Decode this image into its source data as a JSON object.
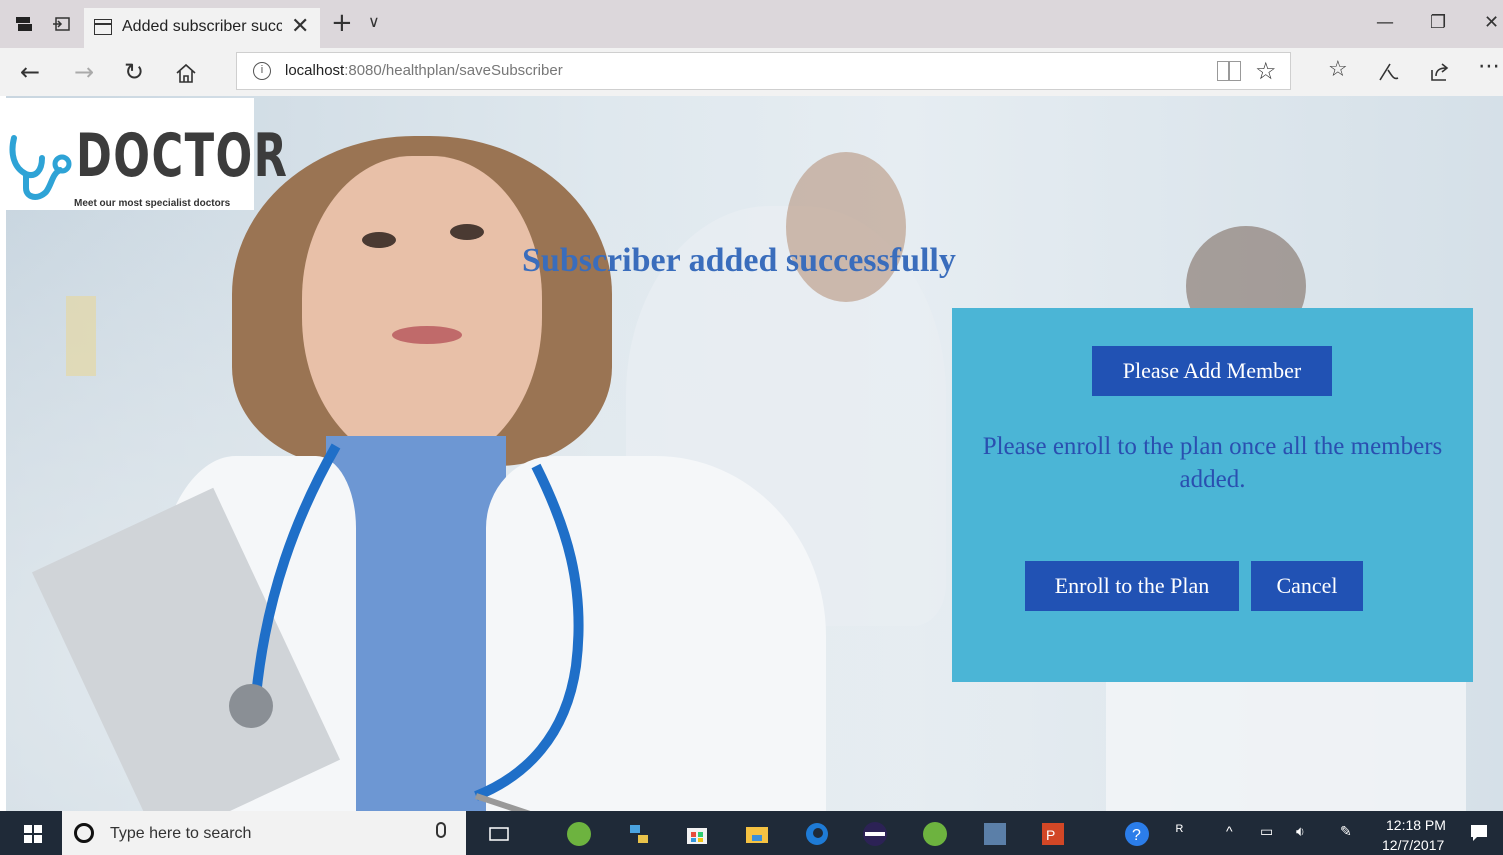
{
  "browser": {
    "tab_title": "Added subscriber succe",
    "tab_close": "✕",
    "new_tab": "+",
    "tab_menu": "∨",
    "url_host": "localhost",
    "url_rest": ":8080/healthplan/saveSubscriber",
    "info": "i"
  },
  "page": {
    "logo_text": "DOCTOR",
    "logo_tagline": "Meet our most specialist doctors",
    "success_message": "Subscriber added successfully",
    "add_member_button": "Please Add Member",
    "enroll_note": "Please enroll to the plan once all the members added.",
    "enroll_button": "Enroll to the Plan",
    "cancel_button": "Cancel"
  },
  "taskbar": {
    "search_placeholder": "Type here to search",
    "time": "12:18 PM",
    "date": "12/7/2017"
  },
  "colors": {
    "panel": "#4bb5d6",
    "button": "#2152b4",
    "heading": "#3a6dbc"
  }
}
